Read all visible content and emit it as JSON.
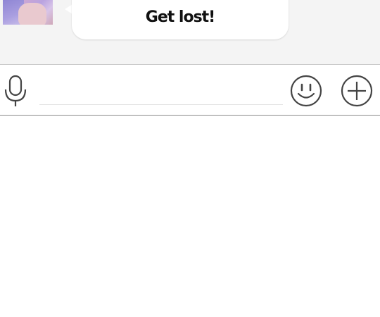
{
  "chat": {
    "messages": [
      {
        "text": "Get lost!"
      }
    ]
  },
  "input": {
    "value": "",
    "placeholder": ""
  },
  "icons": {
    "mic": "microphone-icon",
    "emoji": "smiley-icon",
    "add": "plus-circle-icon"
  },
  "colors": {
    "chat_background": "#f4f4f4",
    "bubble": "#ffffff",
    "icon_stroke": "#444444"
  }
}
